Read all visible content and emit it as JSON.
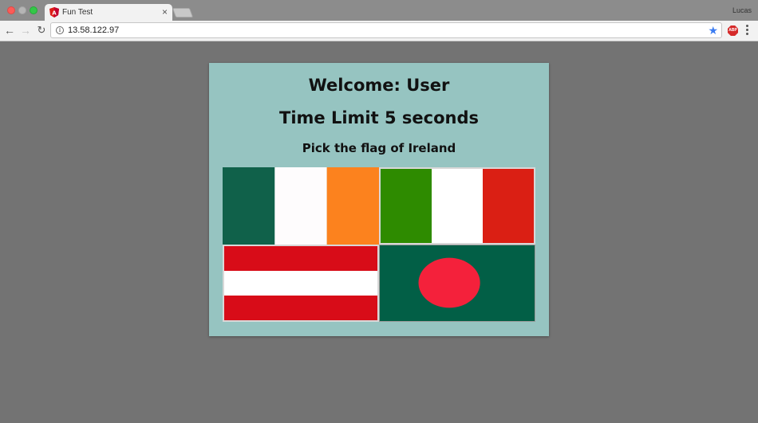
{
  "browser": {
    "tab_title": "Fun Test",
    "tab_close": "×",
    "profile_name": "Lucas",
    "url": "13.58.122.97",
    "star_color": "#3b7cf1"
  },
  "quiz": {
    "welcome": "Welcome: User",
    "time_limit": "Time Limit 5 seconds",
    "prompt": "Pick the flag of Ireland",
    "card_background": "#96c4c1",
    "flags": [
      {
        "name": "ireland",
        "colors": [
          "#10614a",
          "#fefcfd",
          "#fc821e"
        ]
      },
      {
        "name": "italy",
        "colors": [
          "#2e8b00",
          "#ffffff",
          "#da1f14"
        ]
      },
      {
        "name": "austria",
        "colors": [
          "#d80c18",
          "#ffffff",
          "#d80c18"
        ]
      },
      {
        "name": "bangladesh",
        "colors": [
          "#025f46",
          "#f4213b"
        ]
      }
    ]
  }
}
